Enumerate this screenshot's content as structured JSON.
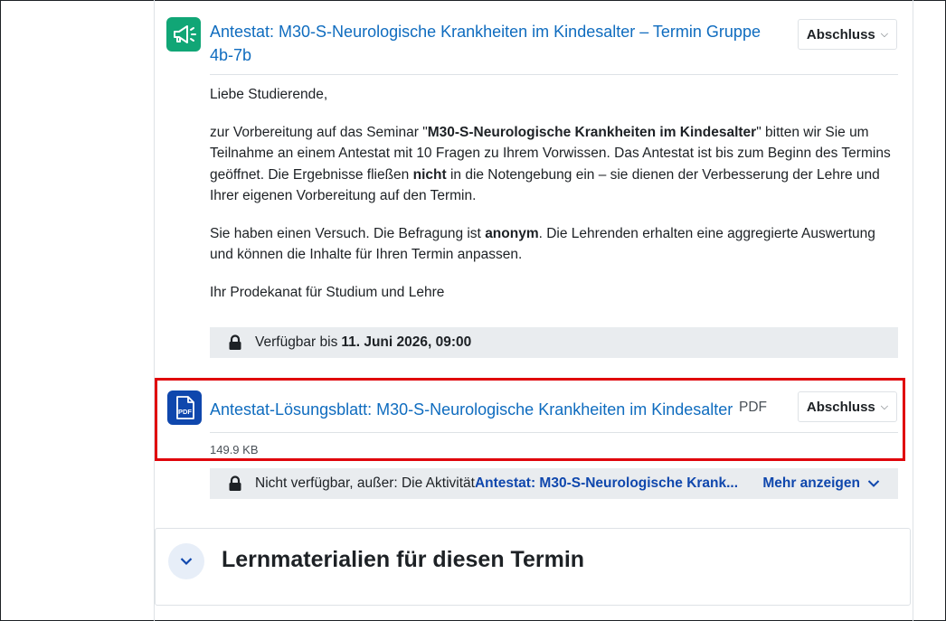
{
  "activity1": {
    "title": "Antestat: M30-S-Neurologische Krankheiten im Kindesalter – Termin Gruppe 4b-7b",
    "completion_label": "Abschluss",
    "description": {
      "greeting": "Liebe Studierende,",
      "p1_a": "zur Vorbereitung auf das Seminar \"",
      "p1_bold": "M30-S-Neurologische Krankheiten im Kindesalter",
      "p1_b": "\" bitten wir Sie um Teilnahme an einem Antestat mit 10 Fragen zu Ihrem Vorwissen. Das Antestat ist bis zum Beginn des Termins geöffnet. Die Ergebnisse fließen ",
      "p1_bold2": "nicht",
      "p1_c": " in die Notengebung ein – sie dienen der Verbesserung der Lehre und Ihrer eigenen Vorbereitung auf den Termin.",
      "p2_a": "Sie haben einen Versuch. Die Befragung ist ",
      "p2_bold": "anonym",
      "p2_b": ". Die Lehrenden erhalten eine aggregierte Auswertung und können die Inhalte für Ihren Termin anpassen.",
      "signature": "Ihr Prodekanat für Studium und Lehre"
    },
    "availability": {
      "prefix": "Verfügbar bis ",
      "date": "11. Juni 2026, 09:00"
    }
  },
  "activity2": {
    "title": "Antestat-Lösungsblatt: M30-S-Neurologische Krankheiten im Kindesalter",
    "type": "PDF",
    "icon_label": "PDF",
    "completion_label": "Abschluss",
    "filesize": "149.9 KB",
    "restriction": {
      "prefix": "Nicht verfügbar, außer: Die Aktivität ",
      "activity": "Antestat: M30-S-Neurologische Krank...",
      "more_label": "Mehr anzeigen"
    }
  },
  "section": {
    "title": "Lernmaterialien für diesen Termin"
  },
  "colors": {
    "link": "#0f6cbf",
    "highlight": "#e0040b",
    "communication_icon": "#11a676",
    "resource_icon": "#0f47ad"
  },
  "icons": {
    "activity1": "megaphone-icon",
    "activity2": "pdf-file-icon",
    "lock": "lock-icon",
    "chevron": "chevron-down-icon"
  }
}
